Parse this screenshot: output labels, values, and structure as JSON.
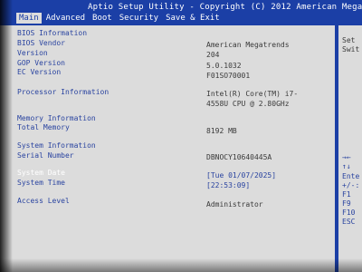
{
  "header": {
    "title": "Aptio Setup Utility - Copyright (C) 2012 American Mega",
    "tabs": [
      "Main",
      "Advanced",
      "Boot",
      "Security",
      "Save & Exit"
    ]
  },
  "main": {
    "bios_info_label": "BIOS Information",
    "bios_vendor_label": "BIOS Vendor",
    "bios_vendor": "American Megatrends",
    "version_label": "Version",
    "version": "204",
    "gop_version_label": "GOP Version",
    "gop_version": "5.0.1032",
    "ec_version_label": "EC Version",
    "ec_version": "F01SO70001",
    "processor_info_label": "Processor Information",
    "processor_line1": "Intel(R) Core(TM) i7-",
    "processor_line2": "4558U CPU @ 2.80GHz",
    "memory_info_label": "Memory Information",
    "total_memory_label": "Total Memory",
    "total_memory": "8192 MB",
    "system_info_label": "System Information",
    "serial_number_label": "Serial Number",
    "serial_number": "DBNOCY10640445A",
    "system_date_label": "System Date",
    "system_date": "[Tue 01/07/2025]",
    "system_time_label": "System Time",
    "system_time": "[22:53:09]",
    "access_level_label": "Access Level",
    "access_level": "Administrator"
  },
  "sidebar": {
    "help_top": [
      "Set",
      "Swit"
    ],
    "keys": [
      "→←",
      "↑↓",
      "Ente",
      "+/-:",
      "F1",
      "F9",
      "F10",
      "ESC"
    ]
  },
  "colors": {
    "header_bg": "#1b3fa6",
    "body_bg": "#dcdcdc",
    "label": "#2a44a0",
    "value": "#3a3a3a",
    "selected": "#ffffff"
  }
}
